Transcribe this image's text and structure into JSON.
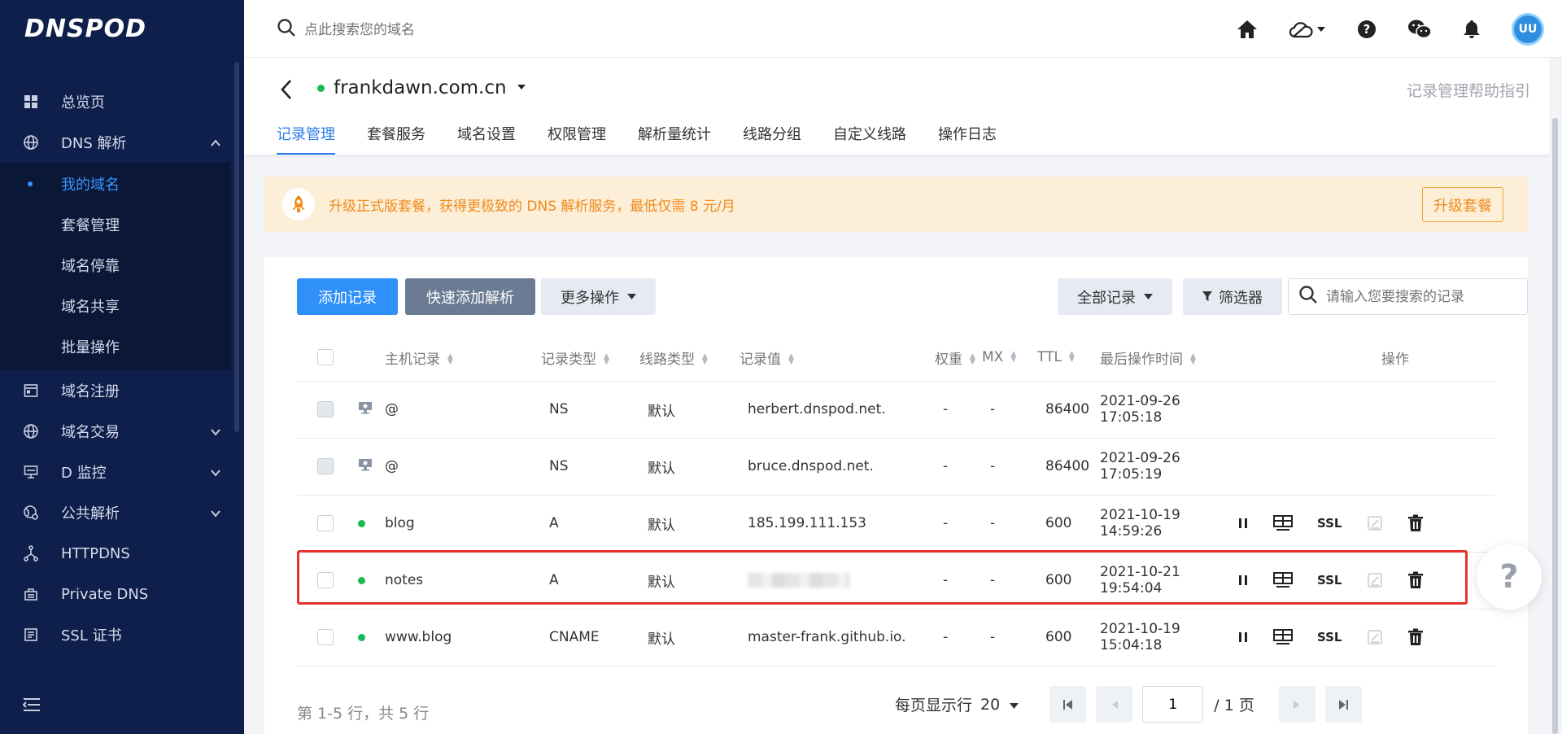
{
  "logo": "DNSPOD",
  "top": {
    "search_placeholder": "点此搜索您的域名",
    "avatar_text": "UU"
  },
  "sidebar": {
    "items": [
      {
        "label": "总览页"
      },
      {
        "label": "DNS 解析"
      },
      {
        "label": "域名注册"
      },
      {
        "label": "域名交易"
      },
      {
        "label": "D 监控"
      },
      {
        "label": "公共解析"
      },
      {
        "label": "HTTPDNS"
      },
      {
        "label": "Private DNS"
      },
      {
        "label": "SSL 证书"
      }
    ],
    "dns_sub": [
      {
        "label": "我的域名"
      },
      {
        "label": "套餐管理"
      },
      {
        "label": "域名停靠"
      },
      {
        "label": "域名共享"
      },
      {
        "label": "批量操作"
      }
    ]
  },
  "domain": {
    "name": "frankdawn.com.cn",
    "help": "记录管理帮助指引",
    "tabs": [
      "记录管理",
      "套餐服务",
      "域名设置",
      "权限管理",
      "解析量统计",
      "线路分组",
      "自定义线路",
      "操作日志"
    ]
  },
  "banner": {
    "text": "升级正式版套餐，获得更极致的 DNS 解析服务，最低仅需 8 元/月",
    "button": "升级套餐"
  },
  "toolbar": {
    "add": "添加记录",
    "quick_add": "快速添加解析",
    "more": "更多操作",
    "all_records": "全部记录",
    "filter": "筛选器",
    "search_placeholder": "请输入您要搜索的记录"
  },
  "table": {
    "headers": [
      "主机记录",
      "记录类型",
      "线路类型",
      "记录值",
      "权重",
      "MX",
      "TTL",
      "最后操作时间",
      "操作"
    ],
    "ssl_label": "SSL",
    "rows": [
      {
        "host": "@",
        "type": "NS",
        "line": "默认",
        "value": "herbert.dnspod.net.",
        "weight": "-",
        "mx": "-",
        "ttl": "86400",
        "time": "2021-09-26 17:05:18"
      },
      {
        "host": "@",
        "type": "NS",
        "line": "默认",
        "value": "bruce.dnspod.net.",
        "weight": "-",
        "mx": "-",
        "ttl": "86400",
        "time": "2021-09-26 17:05:19"
      },
      {
        "host": "blog",
        "type": "A",
        "line": "默认",
        "value": "185.199.111.153",
        "weight": "-",
        "mx": "-",
        "ttl": "600",
        "time": "2021-10-19 14:59:26"
      },
      {
        "host": "notes",
        "type": "A",
        "line": "默认",
        "value": "",
        "weight": "-",
        "mx": "-",
        "ttl": "600",
        "time": "2021-10-21 19:54:04"
      },
      {
        "host": "www.blog",
        "type": "CNAME",
        "line": "默认",
        "value": "master-frank.github.io.",
        "weight": "-",
        "mx": "-",
        "ttl": "600",
        "time": "2021-10-19 15:04:18"
      }
    ]
  },
  "footer": {
    "summary": "第 1-5 行，共 5 行",
    "per_page_label": "每页显示行",
    "per_page": "20",
    "current_page": "1",
    "total_pages": "/ 1 页"
  },
  "float_help": "?",
  "colors": {
    "sidebar_bg": "#0f1f4b",
    "primary": "#2e90f8",
    "accent_blue": "#2a7dea",
    "status_green": "#19b955",
    "banner_bg": "#fdeed8",
    "banner_text": "#f08b1a",
    "highlight": "#e8312b"
  }
}
